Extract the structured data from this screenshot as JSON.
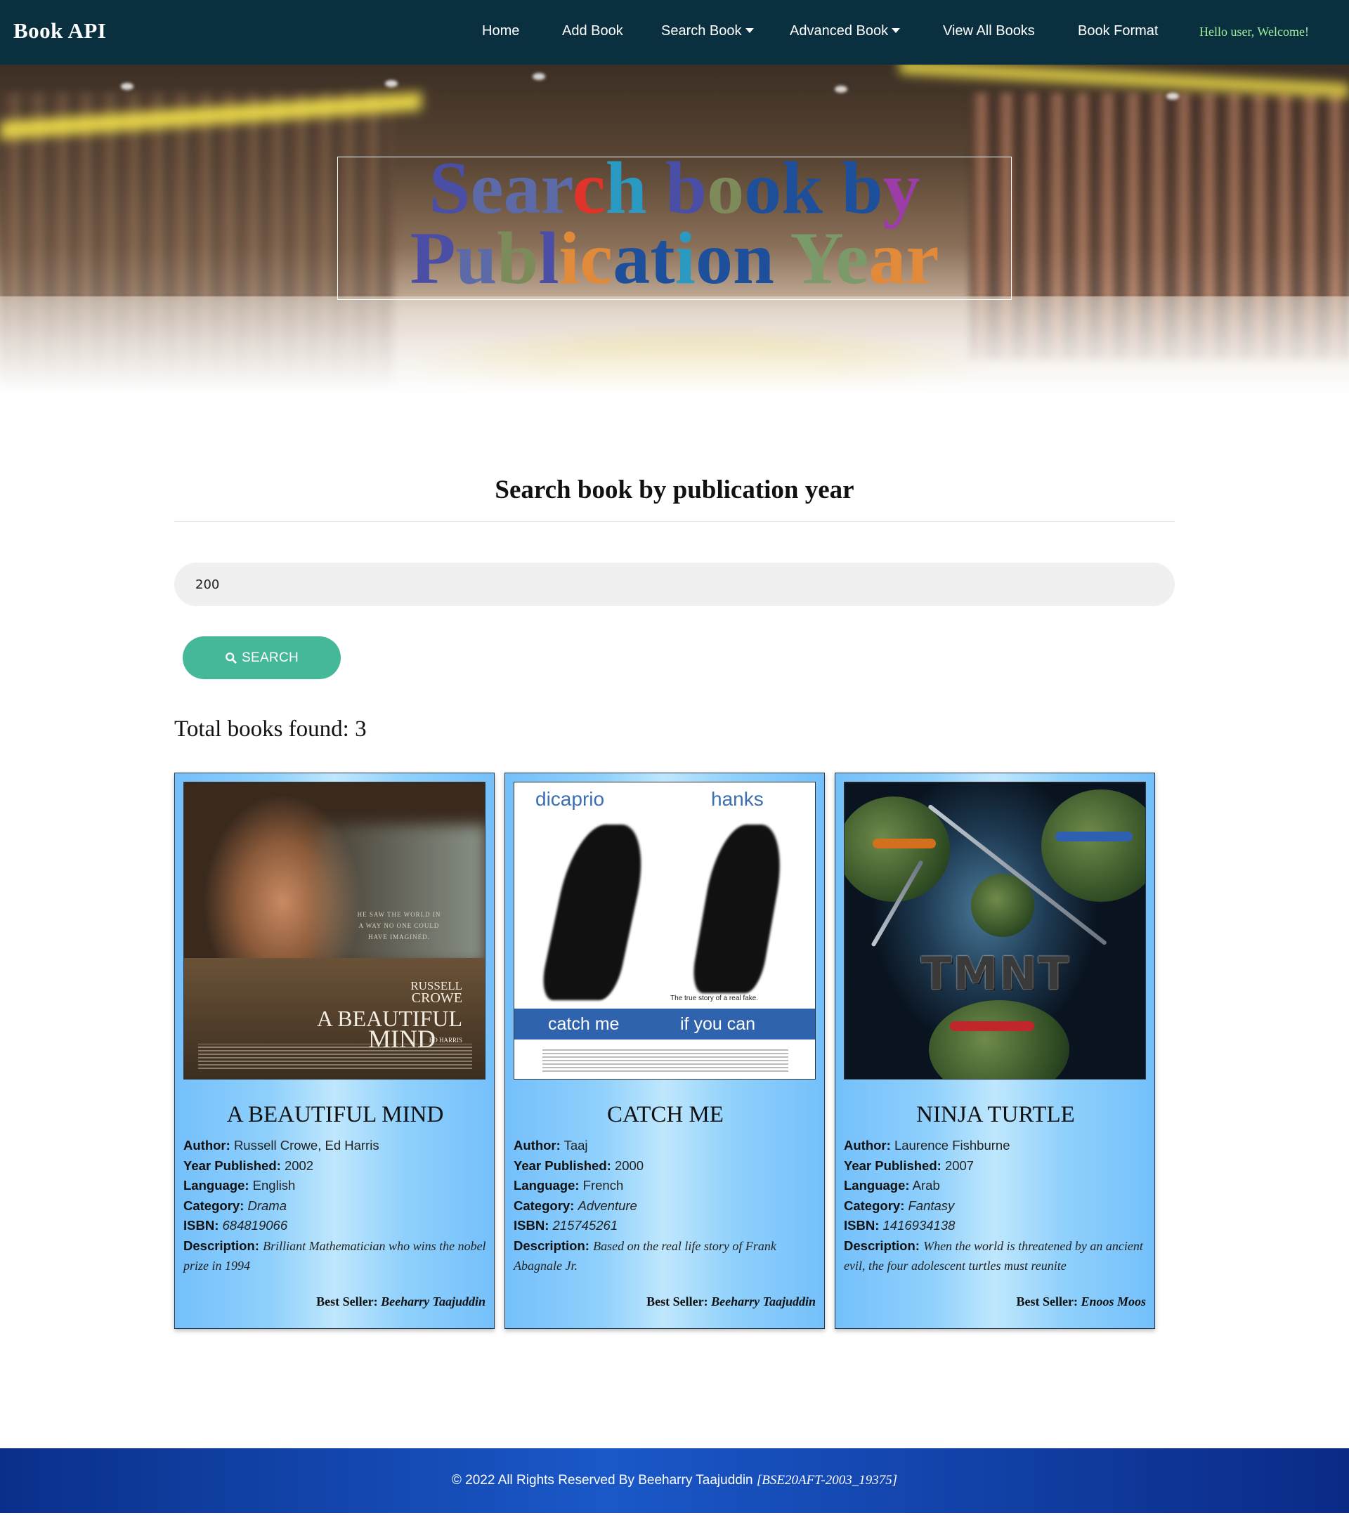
{
  "nav": {
    "brand": "Book API",
    "items": [
      {
        "label": "Home"
      },
      {
        "label": "Add Book"
      },
      {
        "label": "Search Book"
      },
      {
        "label": "Advanced Book"
      },
      {
        "label": "View All Books"
      },
      {
        "label": "Book Format"
      }
    ],
    "welcome": "Hello user, Welcome!"
  },
  "hero": {
    "title_line1": "Search book by",
    "title_line2": "Publication Year"
  },
  "search": {
    "heading": "Search book by publication year",
    "input_value": "200",
    "button_label": "SEARCH",
    "total_label": "Total books found: 3"
  },
  "books": [
    {
      "title": "A BEAUTIFUL MIND",
      "author_label": "Author:",
      "author": "Russell Crowe, Ed Harris",
      "year_label": "Year Published:",
      "year": "2002",
      "language_label": "Language:",
      "language": "English",
      "category_label": "Category:",
      "category": "Drama",
      "isbn_label": "ISBN:",
      "isbn": "684819066",
      "description_label": "Description:",
      "description": "Brilliant Mathematician who wins the nobel prize in 1994",
      "seller_label": "Best Seller:",
      "seller": "Beeharry Taajuddin",
      "poster": {
        "top_credit": "RUSSELL",
        "name": "CROWE",
        "title1": "A BEAUTIFUL",
        "title2": "MIND",
        "co_star": "ED HARRIS",
        "tagline": "HE SAW THE WORLD IN A WAY NO ONE COULD HAVE IMAGINED."
      }
    },
    {
      "title": "CATCH ME",
      "author_label": "Author:",
      "author": "Taaj",
      "year_label": "Year Published:",
      "year": "2000",
      "language_label": "Language:",
      "language": "French",
      "category_label": "Category:",
      "category": "Adventure",
      "isbn_label": "ISBN:",
      "isbn": "215745261",
      "description_label": "Description:",
      "description": "Based on the real life story of Frank Abagnale Jr.",
      "seller_label": "Best Seller:",
      "seller": "Beeharry Taajuddin",
      "poster": {
        "actor1": "dicaprio",
        "actor2": "hanks",
        "tagline": "The true story of a real fake.",
        "title1": "catch me",
        "title2": "if you can"
      }
    },
    {
      "title": "NINJA TURTLE",
      "author_label": "Author:",
      "author": "Laurence Fishburne",
      "year_label": "Year Published:",
      "year": "2007",
      "language_label": "Language:",
      "language": "Arab",
      "category_label": "Category:",
      "category": "Fantasy",
      "isbn_label": "ISBN:",
      "isbn": "1416934138",
      "description_label": "Description:",
      "description": "When the world is threatened by an ancient evil, the four adolescent turtles must reunite",
      "seller_label": "Best Seller:",
      "seller": "Enoos Moos",
      "poster": {
        "logo": "TMNT"
      }
    }
  ],
  "footer": {
    "text": "© 2022 All Rights Reserved By Beeharry Taajuddin",
    "code": "[BSE20AFT-2003_19375]"
  },
  "colors": {
    "navbar": "#0a3040",
    "welcome": "#9ff09a",
    "search_button": "#46b89a",
    "card_blue": "#74c0fb",
    "footer": "#1a58c8"
  },
  "icons": {
    "search_button": "search-icon",
    "dropdown": "caret-down-icon"
  }
}
